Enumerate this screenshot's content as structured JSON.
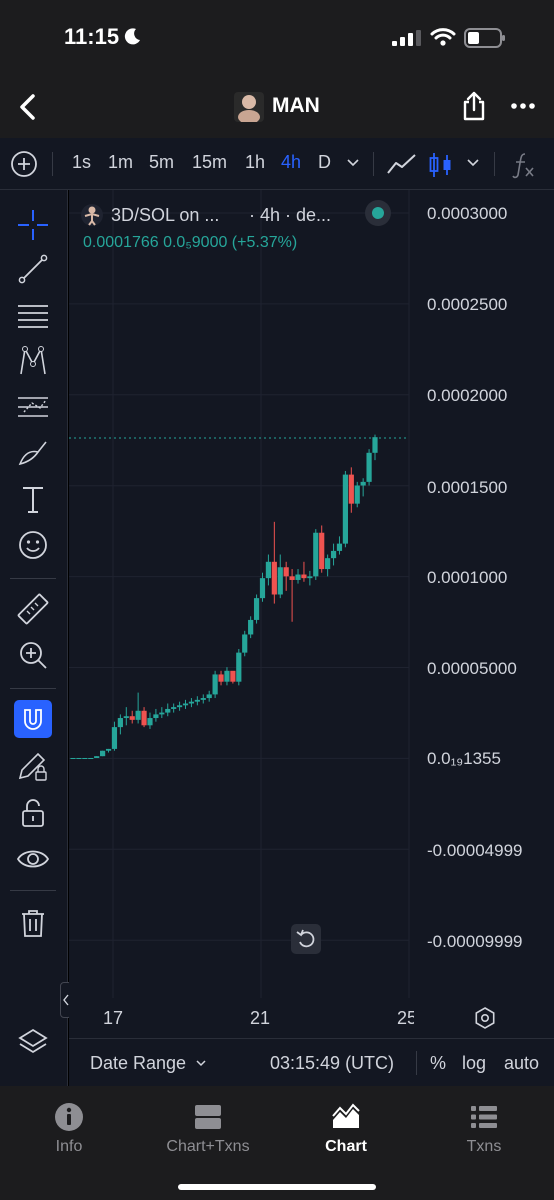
{
  "status_bar": {
    "time": "11:15"
  },
  "header": {
    "token_name": "MAN",
    "colors": {
      "background": "#1c1c1e"
    }
  },
  "toolbar": {
    "intervals": [
      "1s",
      "1m",
      "5m",
      "15m",
      "1h",
      "4h",
      "D"
    ],
    "active_interval": "4h",
    "colors": {
      "accent": "#2962ff"
    }
  },
  "chart": {
    "legend": {
      "title": "3D/SOL on ...",
      "interval_text": "· 4h · de...",
      "values_text": "0.0001766  0.0₅9000 (+5.37%)"
    },
    "price_axis": [
      "0.0003000",
      "0.0002500",
      "0.0002000",
      "0.0001500",
      "0.0001000",
      "0.00005000",
      "0.0₁₉1355",
      "-0.00004999",
      "-0.00009999"
    ],
    "date_axis": [
      "17",
      "21",
      "25"
    ],
    "colors": {
      "up": "#26a69a",
      "down": "#ef5350",
      "background": "#131722",
      "grid": "#1f2330"
    }
  },
  "bottom_bar": {
    "date_range_label": "Date Range",
    "clock": "03:15:49 (UTC)",
    "percent_label": "%",
    "log_label": "log",
    "auto_label": "auto"
  },
  "tabs": [
    {
      "label": "Info",
      "icon": "info-icon"
    },
    {
      "label": "Chart+Txns",
      "icon": "split-view-icon"
    },
    {
      "label": "Chart",
      "icon": "chart-icon",
      "active": true
    },
    {
      "label": "Txns",
      "icon": "list-icon"
    }
  ],
  "chart_data": {
    "type": "candlestick",
    "title": "",
    "xlabel": "",
    "ylabel": "",
    "x_ticks": [
      "17",
      "21",
      "25"
    ],
    "y_ticks": [
      "0.0003000",
      "0.0002500",
      "0.0002000",
      "0.0001500",
      "0.0001000",
      "0.00005000",
      "0.0₁₉1355",
      "-0.00004999",
      "-0.00009999"
    ],
    "ylim": [
      -0.00012,
      0.0003
    ],
    "last_price": 0.0001766,
    "candles": [
      [
        0,
        0,
        0,
        0
      ],
      [
        0,
        0,
        0,
        0
      ],
      [
        0,
        0,
        0,
        0
      ],
      [
        0,
        0,
        0,
        0
      ],
      [
        0,
        1e-06,
        0,
        1e-06
      ],
      [
        1e-06,
        4e-06,
        1e-06,
        4e-06
      ],
      [
        4e-06,
        5e-06,
        3e-06,
        5e-06
      ],
      [
        5e-06,
        2e-05,
        4e-06,
        1.7e-05
      ],
      [
        1.7e-05,
        2.4e-05,
        1.3e-05,
        2.2e-05
      ],
      [
        2.2e-05,
        2.8e-05,
        1.8e-05,
        2.3e-05
      ],
      [
        2.3e-05,
        2.6e-05,
        1.9e-05,
        2.1e-05
      ],
      [
        2.1e-05,
        3.6e-05,
        1.9e-05,
        2.6e-05
      ],
      [
        2.6e-05,
        2.8e-05,
        1.7e-05,
        1.8e-05
      ],
      [
        1.8e-05,
        2.5e-05,
        1.6e-05,
        2.2e-05
      ],
      [
        2.2e-05,
        2.7e-05,
        2e-05,
        2.4e-05
      ],
      [
        2.4e-05,
        2.8e-05,
        2.2e-05,
        2.5e-05
      ],
      [
        2.5e-05,
        3e-05,
        2.3e-05,
        2.7e-05
      ],
      [
        2.7e-05,
        3e-05,
        2.5e-05,
        2.8e-05
      ],
      [
        2.8e-05,
        3.1e-05,
        2.6e-05,
        2.9e-05
      ],
      [
        2.9e-05,
        3.2e-05,
        2.7e-05,
        3e-05
      ],
      [
        3e-05,
        3.3e-05,
        2.8e-05,
        3.1e-05
      ],
      [
        3.1e-05,
        3.4e-05,
        2.9e-05,
        3.2e-05
      ],
      [
        3.2e-05,
        3.5e-05,
        3e-05,
        3.3e-05
      ],
      [
        3.3e-05,
        3.7e-05,
        3.1e-05,
        3.5e-05
      ],
      [
        3.5e-05,
        4.8e-05,
        3.3e-05,
        4.6e-05
      ],
      [
        4.6e-05,
        4.8e-05,
        4e-05,
        4.2e-05
      ],
      [
        4.2e-05,
        5e-05,
        4e-05,
        4.8e-05
      ],
      [
        4.8e-05,
        4.6e-05,
        4.1e-05,
        4.2e-05
      ],
      [
        4.2e-05,
        6e-05,
        4e-05,
        5.8e-05
      ],
      [
        5.8e-05,
        7e-05,
        5.6e-05,
        6.8e-05
      ],
      [
        6.8e-05,
        7.8e-05,
        6.6e-05,
        7.6e-05
      ],
      [
        7.6e-05,
        9e-05,
        7.4e-05,
        8.8e-05
      ],
      [
        8.8e-05,
        0.000102,
        8.6e-05,
        9.9e-05
      ],
      [
        9.9e-05,
        0.000112,
        9.5e-05,
        0.000108
      ],
      [
        0.000108,
        0.00013,
        8.5e-05,
        9e-05
      ],
      [
        9e-05,
        0.000112,
        8.8e-05,
        0.000105
      ],
      [
        0.000105,
        0.000108,
        9.2e-05,
        0.0001
      ],
      [
        0.0001,
        0.000104,
        7.5e-05,
        9.8e-05
      ],
      [
        9.8e-05,
        0.000104,
        9.6e-05,
        0.000101
      ],
      [
        0.000101,
        0.000108,
        9.7e-05,
        9.9e-05
      ],
      [
        9.9e-05,
        0.000103,
        9.5e-05,
        0.0001
      ],
      [
        0.0001,
        0.000126,
        9.8e-05,
        0.000124
      ],
      [
        0.000124,
        0.000128,
        0.000102,
        0.000104
      ],
      [
        0.000104,
        0.000112,
        0.0001,
        0.00011
      ],
      [
        0.00011,
        0.000118,
        0.000106,
        0.000114
      ],
      [
        0.000114,
        0.000122,
        0.000112,
        0.000118
      ],
      [
        0.000118,
        0.000158,
        0.000116,
        0.000156
      ],
      [
        0.000156,
        0.00016,
        0.000135,
        0.00014
      ],
      [
        0.00014,
        0.000152,
        0.000138,
        0.00015
      ],
      [
        0.00015,
        0.000154,
        0.000144,
        0.000152
      ],
      [
        0.000152,
        0.00017,
        0.00015,
        0.000168
      ],
      [
        0.000168,
        0.000178,
        0.000164,
        0.0001766
      ]
    ]
  }
}
